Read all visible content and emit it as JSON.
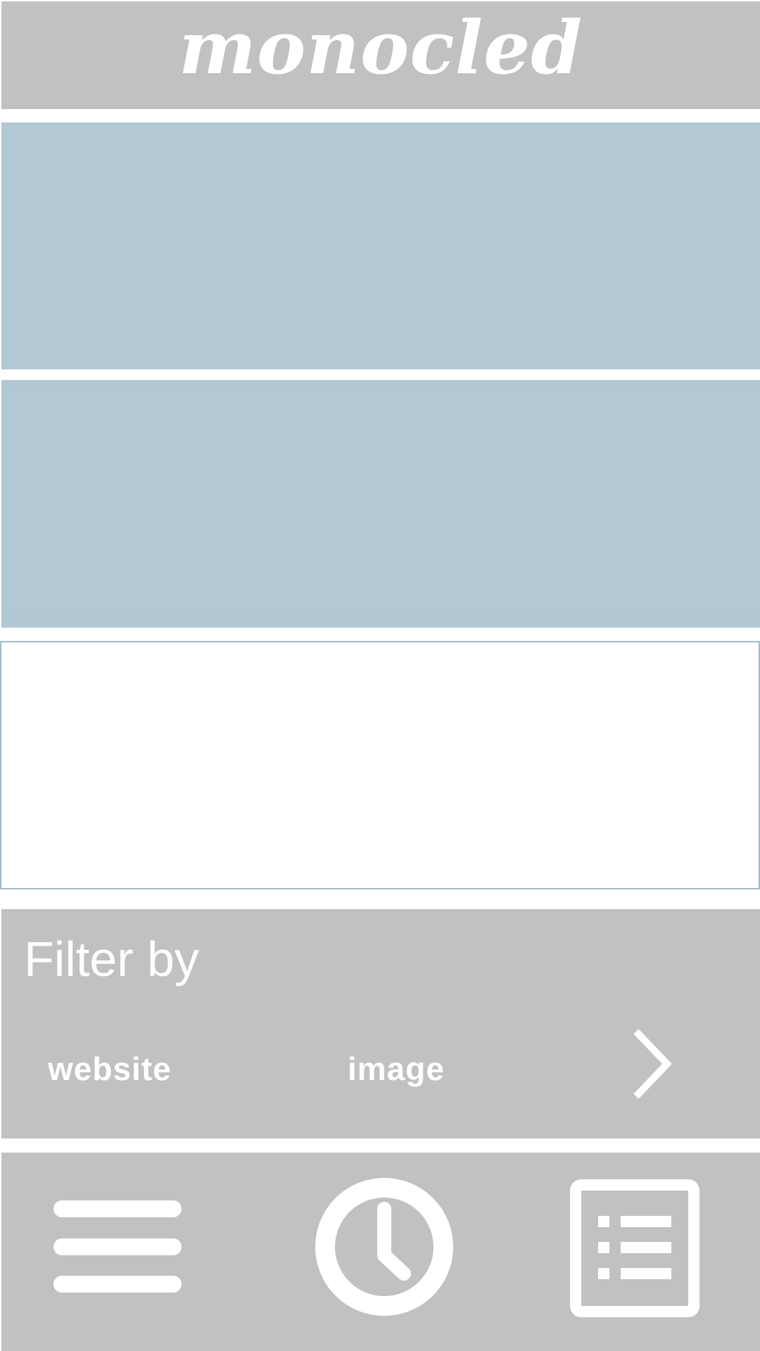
{
  "app": {
    "logo_text": "monocled"
  },
  "filter": {
    "title": "Filter by",
    "options": [
      {
        "label": "website"
      },
      {
        "label": "image"
      }
    ],
    "next_icon": "chevron-right-icon"
  },
  "bottom_nav": {
    "items": [
      {
        "icon": "menu-icon"
      },
      {
        "icon": "clock-icon"
      },
      {
        "icon": "list-icon"
      }
    ]
  },
  "colors": {
    "bar_gray": "#c1c1c1",
    "card_blue": "#b2c9d4",
    "card_border": "#a3bccb",
    "text_white": "#ffffff"
  }
}
